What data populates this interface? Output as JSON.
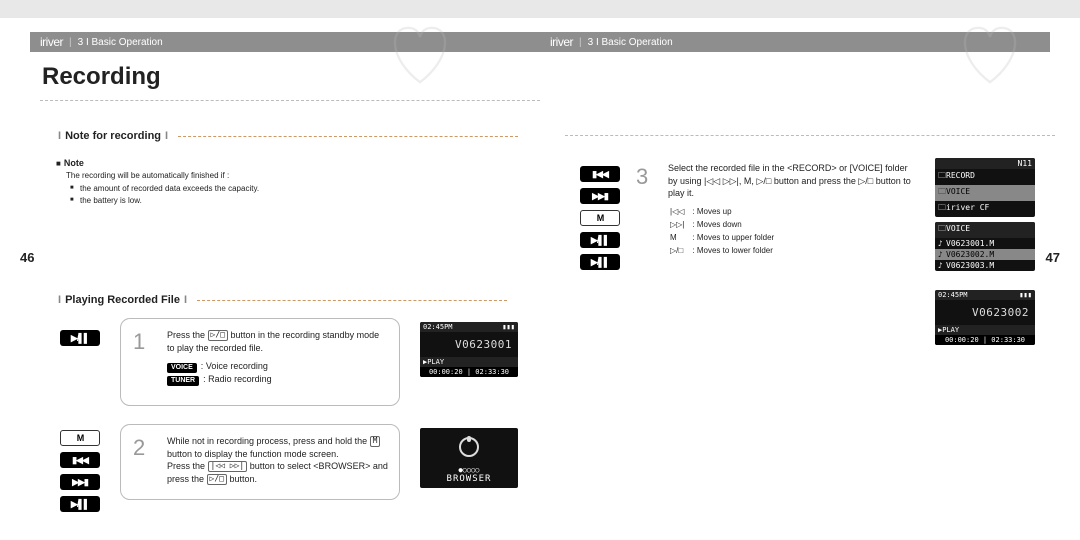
{
  "brand": "iriver",
  "breadcrumb_chapter": "3",
  "breadcrumb_label": "Basic Operation",
  "title": "Recording",
  "page_left": "46",
  "page_right": "47",
  "sections": {
    "note_heading": "Note for recording",
    "play_heading": "Playing Recorded File"
  },
  "note": {
    "label": "Note",
    "intro": "The recording will be automatically finished if :",
    "bullets": [
      "the amount of recorded data exceeds the capacity.",
      "the battery is low."
    ]
  },
  "steps": {
    "1": {
      "text_a": "Press the ",
      "text_b": " button in the recording standby mode to play the recorded file.",
      "tags": [
        {
          "tag": "VOICE",
          "desc": "Voice recording"
        },
        {
          "tag": "TUNER",
          "desc": "Radio recording"
        }
      ],
      "btn_symbol": "▷/□"
    },
    "2": {
      "lines": [
        "While not in recording process, press and hold the",
        " button to display the function mode screen.",
        "Press the ",
        " button to select <BROWSER> and press the ",
        " button."
      ],
      "sym_m": "M",
      "sym_lr": "|◁◁ ▷▷|",
      "sym_play": "▷/□"
    },
    "3": {
      "text": "Select the recorded file in the <RECORD> or [VOICE] folder by using ",
      "text2": " button and press the ",
      "text3": " button to play it.",
      "sym_lr": "|◁◁ ▷▷|",
      "sym_m": "M",
      "sym_play": "▷/□",
      "legend": [
        {
          "k": "|◁◁",
          "v": "Moves up"
        },
        {
          "k": "▷▷|",
          "v": "Moves down"
        },
        {
          "k": "M",
          "v": "Moves to upper folder"
        },
        {
          "k": "▷/□",
          "v": "Moves to lower folder"
        }
      ]
    }
  },
  "icons": {
    "play_pause": "▶/▌▌",
    "m": "M",
    "prev": "▮◀◀",
    "next": "▶▶▮"
  },
  "screens": {
    "play1": {
      "clock": "02:45PM",
      "file": "V0623001",
      "status": "▶PLAY",
      "time": "00:00:20 | 02:33:30"
    },
    "browser": {
      "dots": "●○○○○",
      "label": "BROWSER"
    },
    "folders": {
      "top": "N11",
      "items": [
        "RECORD",
        "VOICE",
        "iriver CF"
      ],
      "sel_index": 1
    },
    "voice": {
      "header": "VOICE",
      "items": [
        "V0623001.M",
        "V0623002.M",
        "V0623003.M"
      ],
      "sel_index": 1
    },
    "play3": {
      "clock": "02:45PM",
      "file": "V0623002",
      "status": "▶PLAY",
      "time": "00:00:20 | 02:33:30"
    }
  }
}
